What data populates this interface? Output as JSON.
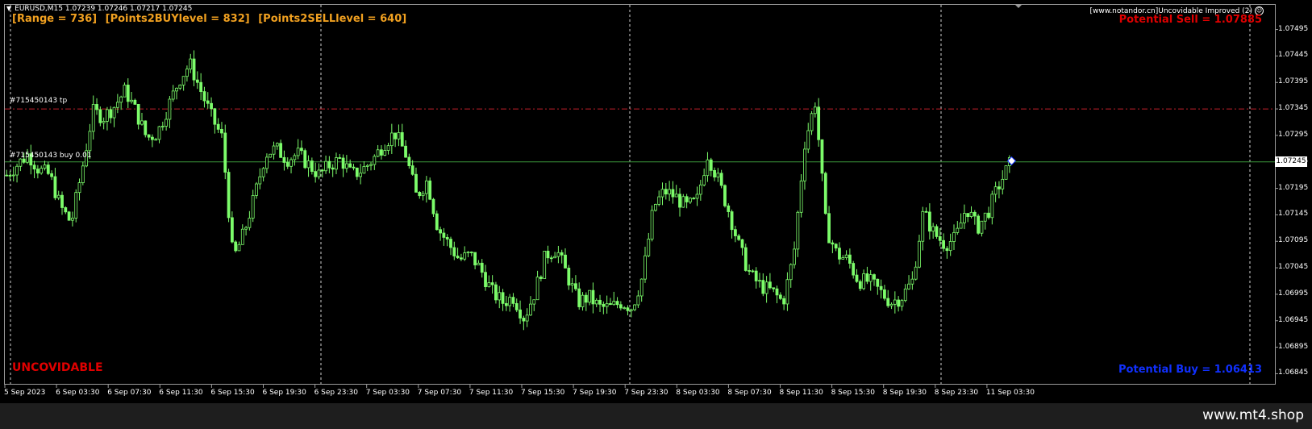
{
  "header": {
    "symbol_line": "EURUSD,M15  1.07239 1.07246 1.07217 1.07245",
    "indicator_name": "[www.notandor.cn]Uncovidable Improved (2)"
  },
  "stats": {
    "range": "[Range = 736]",
    "points_buy": "[Points2BUYlevel = 832]",
    "points_sell": "[Points2SELLlevel = 640]"
  },
  "signals": {
    "potential_sell": "Potential Sell = 1.07885",
    "potential_buy": "Potential Buy = 1.06413",
    "brand": "UNCOVIDABLE"
  },
  "order_lines": {
    "tp_label": "#715450143 tp",
    "order_label": "#715450143 buy 0.01",
    "tp_price": 1.07345,
    "order_price": 1.07245
  },
  "current_price": "1.07245",
  "watermark": "www.mt4.shop",
  "colors": {
    "candle": "#7cfc6a",
    "tp_line": "#c0202a",
    "order_line": "#3c9a3c",
    "sell_text": "#e00000",
    "buy_text": "#1030ff",
    "stats_text": "#f0a020"
  },
  "chart_data": {
    "type": "candlestick",
    "symbol": "EURUSD",
    "timeframe": "M15",
    "ylim": [
      1.06835,
      1.07505
    ],
    "y_ticks": [
      "1.07495",
      "1.07445",
      "1.07395",
      "1.07345",
      "1.07295",
      "1.07245",
      "1.07195",
      "1.07145",
      "1.07095",
      "1.07045",
      "1.06995",
      "1.06945",
      "1.06895",
      "1.06845"
    ],
    "x_ticks": [
      "5 Sep 2023",
      "6 Sep 03:30",
      "6 Sep 07:30",
      "6 Sep 11:30",
      "6 Sep 15:30",
      "6 Sep 19:30",
      "6 Sep 23:30",
      "7 Sep 03:30",
      "7 Sep 07:30",
      "7 Sep 11:30",
      "7 Sep 15:30",
      "7 Sep 19:30",
      "7 Sep 23:30",
      "8 Sep 03:30",
      "8 Sep 07:30",
      "8 Sep 11:30",
      "8 Sep 15:30",
      "8 Sep 19:30",
      "8 Sep 23:30",
      "11 Sep 03:30"
    ],
    "close_path": [
      1.0722,
      1.0724,
      1.0726,
      1.0723,
      1.0722,
      1.0716,
      1.0713,
      1.0723,
      1.0734,
      1.0733,
      1.0735,
      1.0738,
      1.0734,
      1.0729,
      1.073,
      1.0735,
      1.074,
      1.0743,
      1.0738,
      1.0733,
      1.0729,
      1.0706,
      1.0711,
      1.0718,
      1.0726,
      1.0727,
      1.0725,
      1.0726,
      1.0724,
      1.0722,
      1.0724,
      1.0725,
      1.0722,
      1.0723,
      1.0725,
      1.0728,
      1.073,
      1.0726,
      1.0718,
      1.0721,
      1.0712,
      1.0709,
      1.0706,
      1.0707,
      1.0704,
      1.07,
      1.0698,
      1.0699,
      1.0695,
      1.07,
      1.0707,
      1.0708,
      1.0703,
      1.0698,
      1.0699,
      1.0697,
      1.0697,
      1.0698,
      1.0697,
      1.0703,
      1.0716,
      1.0719,
      1.0718,
      1.0716,
      1.0717,
      1.0726,
      1.0721,
      1.0715,
      1.0708,
      1.0703,
      1.0701,
      1.07,
      1.0698,
      1.0707,
      1.0728,
      1.0736,
      1.0712,
      1.0707,
      1.0706,
      1.0702,
      1.0702,
      1.07,
      1.0698,
      1.0699,
      1.0702,
      1.0715,
      1.0711,
      1.0709,
      1.071,
      1.0716,
      1.0712,
      1.0715,
      1.072,
      1.0724
    ]
  }
}
